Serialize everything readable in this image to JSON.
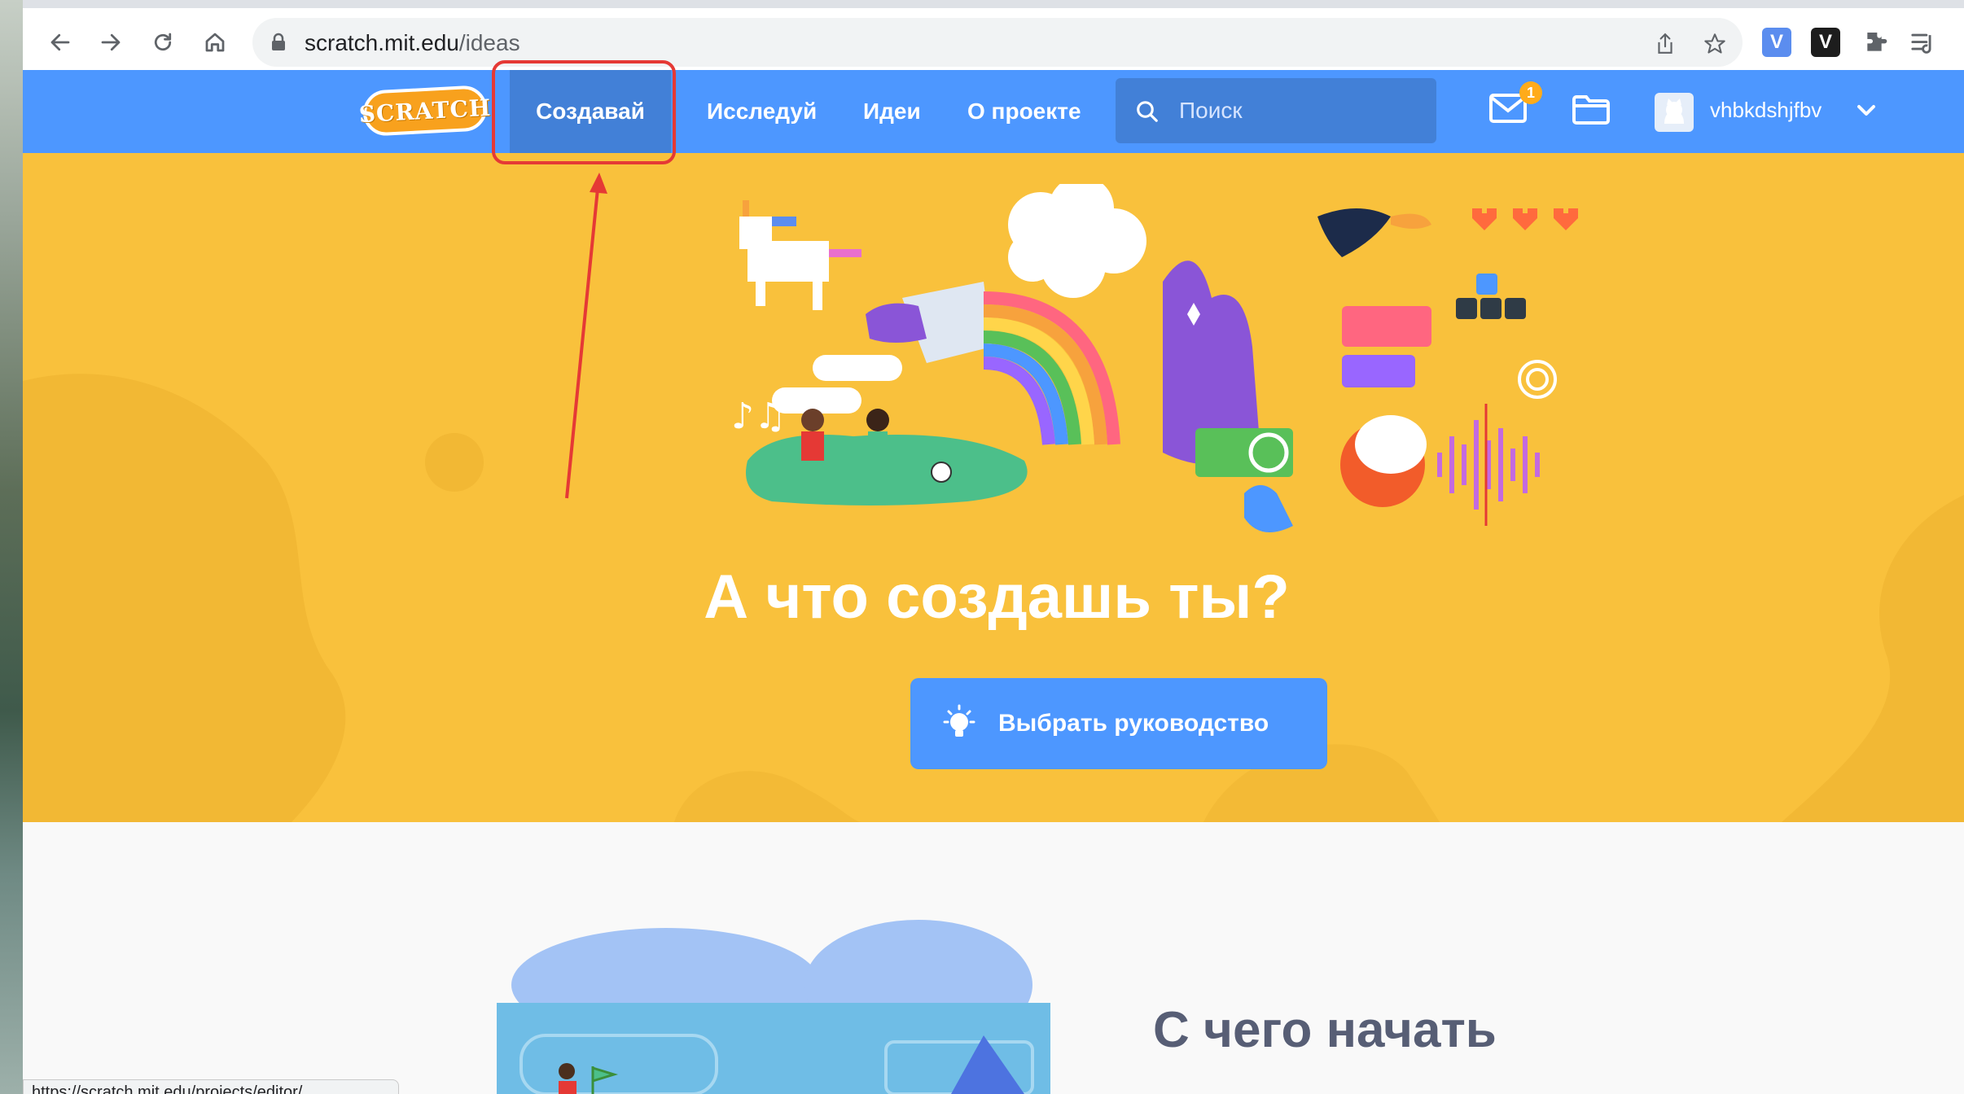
{
  "browser": {
    "url_domain": "scratch.mit.edu",
    "url_path": "/ideas",
    "status_url": "https://scratch.mit.edu/projects/editor/"
  },
  "nav": {
    "logo_text": "SCRATCH",
    "items": [
      "Создавай",
      "Исследуй",
      "Идеи",
      "О проекте"
    ],
    "active_index": 0,
    "search_placeholder": "Поиск",
    "messages_count": "1",
    "username": "vhbkdshjfbv"
  },
  "hero": {
    "title": "А что создашь ты?",
    "cta_label": "Выбрать руководство"
  },
  "section": {
    "title": "С чего начать"
  },
  "colors": {
    "nav_blue": "#4d97ff",
    "nav_active": "#4280d7",
    "hero_yellow": "#f9c13c",
    "annotation_red": "#e53935"
  }
}
